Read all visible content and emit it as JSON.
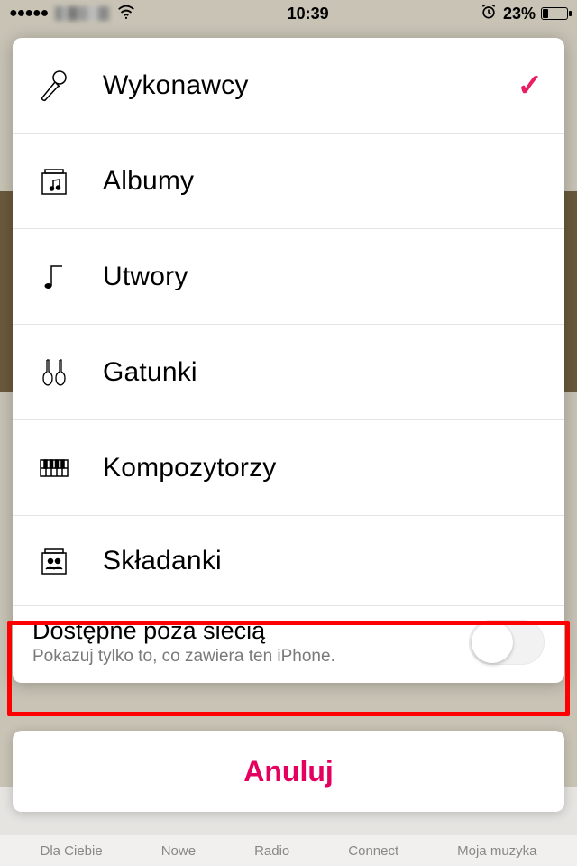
{
  "status": {
    "time": "10:39",
    "battery_pct": "23%",
    "signal_dots": "●●●●●",
    "wifi": "wifi-icon",
    "alarm": "alarm-icon"
  },
  "menu": {
    "items": [
      {
        "icon": "microphone-icon",
        "label": "Wykonawcy",
        "selected": true
      },
      {
        "icon": "album-icon",
        "label": "Albumy",
        "selected": false
      },
      {
        "icon": "note-icon",
        "label": "Utwory",
        "selected": false
      },
      {
        "icon": "guitars-icon",
        "label": "Gatunki",
        "selected": false
      },
      {
        "icon": "piano-icon",
        "label": "Kompozytorzy",
        "selected": false
      },
      {
        "icon": "people-album-icon",
        "label": "Składanki",
        "selected": false
      }
    ],
    "offline": {
      "title": "Dostępne poza siecią",
      "subtitle": "Pokazuj tylko to, co zawiera ten iPhone.",
      "on": false
    }
  },
  "cancel_label": "Anuluj",
  "bg_tabs": [
    "Dla Ciebie",
    "Nowe",
    "Radio",
    "Connect",
    "Moja muzyka"
  ]
}
